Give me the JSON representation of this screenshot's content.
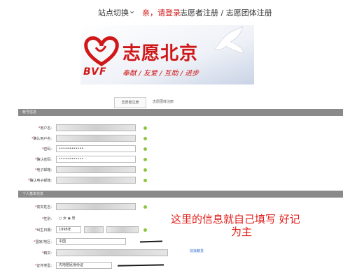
{
  "header": {
    "site_switch": "站点切换",
    "greeting": "亲，请登录",
    "register_links": "志愿者注册 / 志愿团体注册"
  },
  "banner": {
    "title": "志愿北京",
    "brand": "BVF",
    "slogan": "奉献 / 友爱 / 互助 / 进步"
  },
  "colors": {
    "brand_red": "#d01818",
    "section_gray": "#8a8a8a",
    "ok_green": "#8dc63f",
    "link_blue": "#2a66c9"
  },
  "tabs": [
    "志愿者注册",
    "志愿团体注册"
  ],
  "account_section": {
    "title": "帐号信息",
    "rows": [
      {
        "label": "用户名:",
        "value": ""
      },
      {
        "label": "确认用户名:",
        "value": ""
      },
      {
        "label": "密码:",
        "value": "••••••••••••"
      },
      {
        "label": "确认密码:",
        "value": "••••••••••••"
      },
      {
        "label": "电子邮箱:",
        "value": ""
      },
      {
        "label": "确认电子邮箱:",
        "value": ""
      }
    ]
  },
  "personal_section": {
    "title": "个人基本信息",
    "name_label": "真实姓名:",
    "gender_label": "性别:",
    "gender_options": [
      "女",
      "男"
    ],
    "birth_label": "出生日期:",
    "birth_year": "1998年",
    "region_label": "国家/地区:",
    "region_value": "中国",
    "origin_label": "籍贯:",
    "origin_link": "快找籍贯",
    "id_type_label": "证件类型:",
    "id_type_value": "内地居民身份证"
  },
  "annotation": {
    "line1": "这里的信息就自己填写 好记",
    "line2": "为主"
  }
}
